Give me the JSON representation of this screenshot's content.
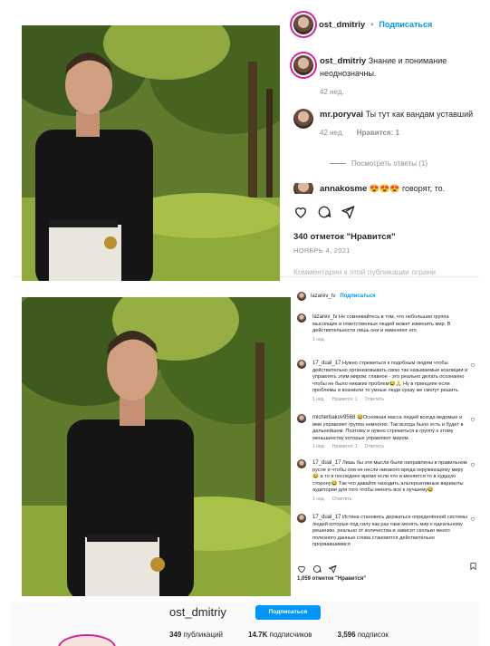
{
  "post1": {
    "username": "ost_dmitriy",
    "separator": "•",
    "follow_label": "Подписаться",
    "caption_user": "ost_dmitriy",
    "caption_text": "Знание и понимание неоднозначны.",
    "caption_time": "42 нед.",
    "comment": {
      "user": "mr.poryvai",
      "text": "Ты тут как вандам уставший",
      "time": "42 нед.",
      "likes": "Нравится: 1"
    },
    "view_replies": "Посмотреть ответы (1)",
    "partial_comment": {
      "user": "annakosme",
      "emoji": "😍😍😍",
      "text": "говорят, то."
    },
    "likes": "340 отметок \"Нравится\"",
    "date": "НОЯБРЬ 4, 2021",
    "add_comment": "Комментарии к этой публикации ограни"
  },
  "post2": {
    "username": "lazarev_tv",
    "follow_label": "Подписаться",
    "comments": [
      {
        "user": "lazarev_tv",
        "text": "Не сомневайтесь в том, что небольшая группа мыслящих и ответственных людей может изменить мир. В действительности лишь они и изменяют его.",
        "meta": [
          "1 нед."
        ]
      },
      {
        "user": "17_dual_17",
        "text": "Нужно стремиться к подобным людям чтобы действительно организовывать свою так называемые коалиции и управлять этим миром, главное - это реально делать осознанно чтобы не было никаких проблем😂🙏 Ну в принципе если проблемы и возникли то умные люди сразу же смогут решить",
        "meta": [
          "1 нед.",
          "Нравится: 1",
          "Ответить"
        ]
      },
      {
        "user": "micherbakov9568",
        "text": "😂Основная масса людей всегда ведомые и ими управляет группа немногих. Так всегда было есть и будет в дальнейшем. Поэтому и нужно стремиться в группу к этому меньшинству которые управляют миром.",
        "meta": [
          "1 нед.",
          "Нравится: 1",
          "Ответить"
        ]
      },
      {
        "user": "17_dual_17",
        "text": "Лишь бы эти мысли были направлены в правильном русле и чтобы они не несли никакого вреда окружающему миру😂 а то в последнее время если что и меняется то в худшую сторону😂 Так что давайте находить альтернативные варианты аудитории для того чтобы менять всё к лучшему😂",
        "meta": [
          "1 нед.",
          "Ответить"
        ]
      },
      {
        "user": "17_dual_17",
        "text": "Истина становясь держаться определённой системы людей которые под силу как раз таки менять мир к идеальному решению. реально от количества и зависит сколько много полезного данные слова становятся действительно прорвавшимися",
        "meta": []
      }
    ],
    "likes": "1,059 отметок \"Нравится\""
  },
  "profile": {
    "name": "ost_dmitriy",
    "follow_label": "Подписаться",
    "posts": "349",
    "posts_label": "публикаций",
    "followers": "14.7K",
    "followers_label": "подписчиков",
    "following": "3,596",
    "following_label": "подписок"
  },
  "colors": {
    "accent": "#0095f6",
    "story_ring": "#d6249f"
  }
}
